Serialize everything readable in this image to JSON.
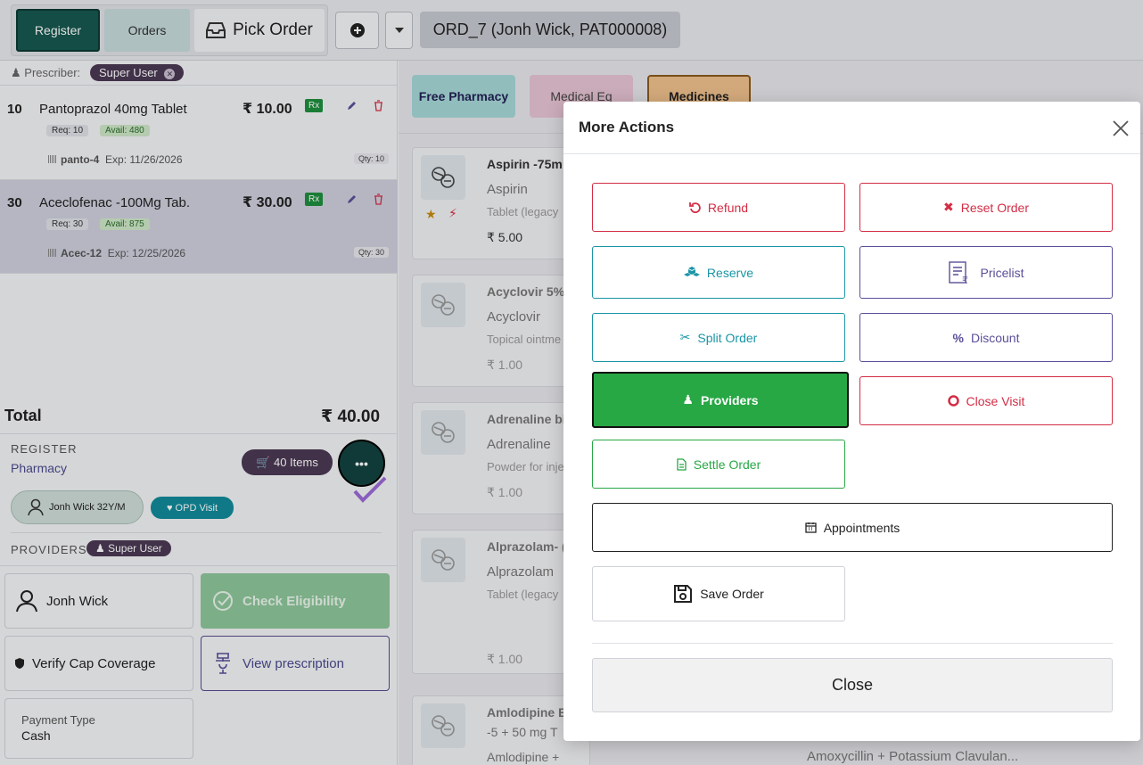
{
  "topbar": {
    "tabs": [
      "Register",
      "Orders",
      "Pick Order"
    ],
    "order_label": "ORD_7 (Jonh Wick, PAT000008)"
  },
  "prescriber": {
    "label": "Prescriber:",
    "value": "Super User"
  },
  "cart_items": [
    {
      "num": "10",
      "name": "Pantoprazol 40mg Tablet",
      "price": "₹ 10.00",
      "rx": "Rx",
      "req": "Req: 10",
      "avail": "Avail: 480",
      "batch": "panto-4",
      "exp": "Exp: 11/26/2026",
      "qty": "Qty: 10"
    },
    {
      "num": "30",
      "name": "Aceclofenac -100Mg Tab.",
      "price": "₹ 30.00",
      "rx": "Rx",
      "req": "Req: 30",
      "avail": "Avail: 875",
      "batch": "Acec-12",
      "exp": "Exp: 12/25/2026",
      "qty": "Qty: 30"
    }
  ],
  "summary": {
    "total_label": "Total",
    "total_value": "₹ 40.00",
    "register_label": "REGISTER",
    "register_value": "Pharmacy",
    "items_label": "40 Items",
    "patient_label": "Jonh Wick 32Y/M",
    "visit_label": "OPD Visit",
    "providers_label": "PROVIDERS",
    "providers_user": "Super User"
  },
  "provider_cards": {
    "patient": "Jonh Wick",
    "eligibility": "Check Eligibility",
    "verify_cap": "Verify Cap Coverage",
    "view_prescription": "View prescription",
    "payment_type_label": "Payment Type",
    "payment_type_value": "Cash"
  },
  "categories": [
    "Free Pharmacy",
    "Medical Eq",
    "Medicines"
  ],
  "products": [
    {
      "title": "Aspirin -75m",
      "generic": "Aspirin",
      "form": "Tablet (legacy",
      "price": "₹ 5.00"
    },
    {
      "title": "Acyclovir 5%",
      "generic": "Acyclovir",
      "form": "Topical ointme",
      "price": "₹ 1.00"
    },
    {
      "title": "Adrenaline bi",
      "generic": "Adrenaline",
      "form": "Powder for inje",
      "price": "₹ 1.00"
    },
    {
      "title": "Alprazolam- (",
      "generic": "Alprazolam",
      "form": "Tablet (legacy",
      "price": "₹ 1.00"
    },
    {
      "title": "Amlodipine B",
      "subtitle": "-5 + 50 mg T",
      "generic": "Amlodipine + Losartan"
    }
  ],
  "bottom_product": "Amoxycillin + Potassium Clavulan...",
  "modal": {
    "title": "More Actions",
    "actions": {
      "refund": "Refund",
      "reset_order": "Reset Order",
      "reserve": "Reserve",
      "pricelist": "Pricelist",
      "split_order": "Split Order",
      "discount": "Discount",
      "providers": "Providers",
      "close_visit": "Close Visit",
      "settle_order": "Settle Order",
      "appointments": "Appointments",
      "save_order": "Save Order"
    },
    "close_label": "Close"
  },
  "colors": {
    "brand_dark": "#16584f",
    "danger": "#d32d45",
    "teal": "#1a95a6",
    "purple": "#5b4f99",
    "success": "#28a745"
  }
}
